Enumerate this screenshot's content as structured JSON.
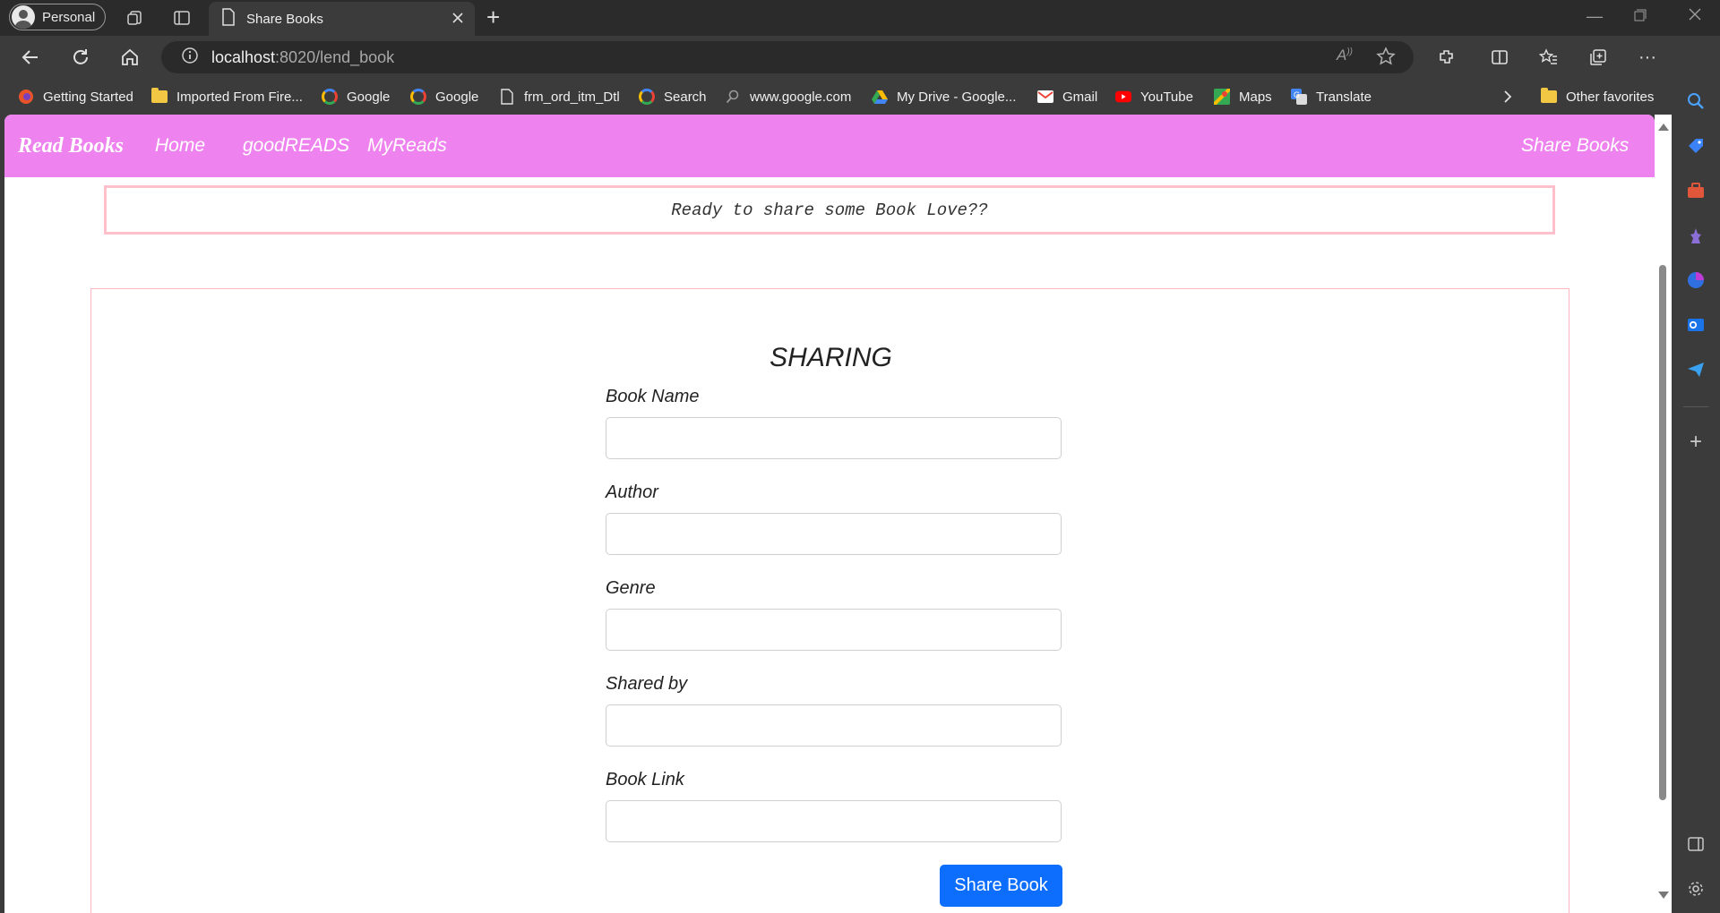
{
  "browser": {
    "profile_label": "Personal",
    "tab_title": "Share Books",
    "url_host": "localhost",
    "url_rest": ":8020/lend_book"
  },
  "bookmarks": [
    {
      "label": "Getting Started",
      "icon": "firefox-icon"
    },
    {
      "label": "Imported From Fire...",
      "icon": "folder-icon"
    },
    {
      "label": "Google",
      "icon": "google-icon"
    },
    {
      "label": "Google",
      "icon": "google-icon"
    },
    {
      "label": "frm_ord_itm_Dtl",
      "icon": "page-icon"
    },
    {
      "label": "Search",
      "icon": "google-icon"
    },
    {
      "label": "www.google.com",
      "icon": "search-icon"
    },
    {
      "label": "My Drive - Google...",
      "icon": "drive-icon"
    },
    {
      "label": "Gmail",
      "icon": "gmail-icon"
    },
    {
      "label": "YouTube",
      "icon": "youtube-icon"
    },
    {
      "label": "Maps",
      "icon": "maps-icon"
    },
    {
      "label": "Translate",
      "icon": "translate-icon"
    }
  ],
  "other_favorites": "Other favorites",
  "site": {
    "brand": "Read Books",
    "nav": [
      "Home",
      "goodREADS",
      "MyReads"
    ],
    "nav_right": "Share Books",
    "banner": "Ready to share some Book Love??"
  },
  "form": {
    "title": "SHARING",
    "fields": [
      {
        "label": "Book Name",
        "value": ""
      },
      {
        "label": "Author",
        "value": ""
      },
      {
        "label": "Genre",
        "value": ""
      },
      {
        "label": "Shared by",
        "value": ""
      },
      {
        "label": "Book Link",
        "value": ""
      }
    ],
    "submit_label": "Share Book"
  },
  "colors": {
    "nav_bg": "#ee82ee",
    "banner_border": "#ffc0cb",
    "button": "#0d6efd"
  }
}
